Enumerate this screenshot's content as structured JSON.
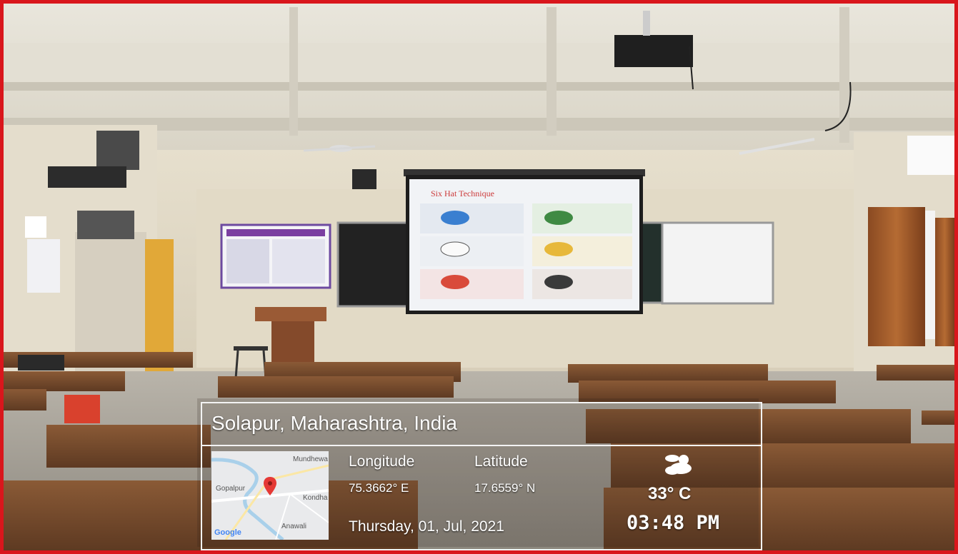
{
  "location": {
    "title": "Solapur, Maharashtra, India"
  },
  "coords": {
    "longitude_label": "Longitude",
    "latitude_label": "Latitude",
    "longitude_value": "75.3662° E",
    "latitude_value": "17.6559° N"
  },
  "date": "Thursday, 01, Jul, 2021",
  "weather": {
    "temperature": "33° C",
    "icon": "partly-cloudy-icon"
  },
  "time": "03:48 PM",
  "map": {
    "labels": {
      "top_right": "Mundhewa",
      "left": "Gopalpur",
      "right": "Kondha",
      "bottom": "Anawali"
    },
    "logo": "Google"
  },
  "slide": {
    "title": "Six Hat Technique"
  },
  "colors": {
    "frame": "#d9161c",
    "pin": "#e53935",
    "overlay_border": "#f3f3f3"
  }
}
